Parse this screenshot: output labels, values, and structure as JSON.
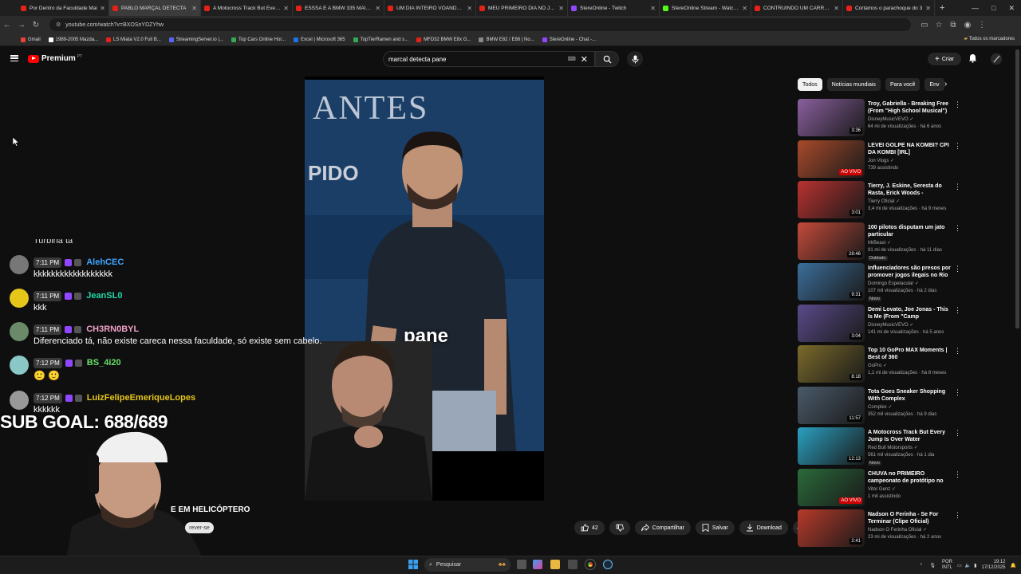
{
  "browser": {
    "tabs": [
      {
        "title": "Por Dentro da Faculdade Mai",
        "color": "#e62117"
      },
      {
        "title": "PABLO MARÇAL DETECTA",
        "color": "#e62117",
        "active": true
      },
      {
        "title": "A Motocross Track But Every J",
        "color": "#e62117"
      },
      {
        "title": "ESSSA É A BMW 335 MAIS LE",
        "color": "#e62117"
      },
      {
        "title": "UM DIA INTEIRO VOANDO PE",
        "color": "#e62117"
      },
      {
        "title": "MEU PRIMEIRO DIA NO JAPÃ",
        "color": "#e62117"
      },
      {
        "title": "StereOnline - Twitch",
        "color": "#9147ff"
      },
      {
        "title": "StereOnline Stream - Watch L",
        "color": "#53fc18"
      },
      {
        "title": "CONTRUINDO UM CARRO EM",
        "color": "#e62117"
      },
      {
        "title": "Cortamos o parachoque do 3",
        "color": "#e62117"
      }
    ],
    "url": "youtube.com/watch?v=BXOSnYDZYhw",
    "bookmarks": [
      {
        "label": "Gmail",
        "color": "#ea4335"
      },
      {
        "label": "1989-2005 Mazda...",
        "color": "#ffffff"
      },
      {
        "label": "LS Miata V2.0 Full B...",
        "color": "#e62117"
      },
      {
        "label": "StreamingServer.io |...",
        "color": "#5865f2"
      },
      {
        "label": "Top Cars Online Hor...",
        "color": "#34a853"
      },
      {
        "label": "Excel | Microsoft 365",
        "color": "#1a73e8"
      },
      {
        "label": "TopTierRamen and s...",
        "color": "#34a853"
      },
      {
        "label": "MFD32 BMW E8x G...",
        "color": "#e62117"
      },
      {
        "label": "BMW E82 / E88 | No...",
        "color": "#888888"
      },
      {
        "label": "StereOnline - Chat -...",
        "color": "#9147ff"
      }
    ],
    "bookmarks_right": "Todos os marcadores"
  },
  "youtube": {
    "logo_text": "Premium",
    "logo_country": "PT",
    "search_value": "marcal detecta pane",
    "create_label": "Criar",
    "caption": "pane",
    "channel_title_fragment": "E EM HELICÓPTERO",
    "subscribe_fragment": "rever-se",
    "likes": "42",
    "share_label": "Compartilhar",
    "save_label": "Salvar",
    "download_label": "Download",
    "chips": [
      "Todos",
      "Notícias mundiais",
      "Para você",
      "Env"
    ],
    "recommendations": [
      {
        "title": "Troy, Gabriella - Breaking Free (From \"High School Musical\")",
        "channel": "DisneyMusicVEVO",
        "meta": "64 mi de visualizações · há 6 anos",
        "duration": "3:36",
        "thumb": "#8a5f9e"
      },
      {
        "title": "LEVEI GOLPE NA KOMBI? CPI DA KOMBI [IRL]",
        "channel": "Jon Vlogs",
        "meta": "739 assistindo",
        "live": "AO VIVO",
        "thumb": "#a84a2a"
      },
      {
        "title": "Tierry, J. Eskine, Seresta do Rasta, Erick Woods - COSTUR...",
        "channel": "Tierry Oficial",
        "meta": "3,4 mi de visualizações · há 9 meses",
        "duration": "3:01",
        "thumb": "#b8322f"
      },
      {
        "title": "100 pilotos disputam um jato particular",
        "channel": "MrBeast",
        "meta": "91 mi de visualizações · há 11 dias",
        "duration": "28:46",
        "thumb": "#c44a3a",
        "note": "Dublado"
      },
      {
        "title": "Influenciadores são presos por promover jogos ilegais no Rio ...",
        "channel": "Domingo Espetacular",
        "meta": "107 mil visualizações · há 2 dias",
        "duration": "9:31",
        "thumb": "#3b6e9a",
        "note": "Novo"
      },
      {
        "title": "Demi Lovato, Joe Jonas - This Is Me (From \"Camp Rock\"/Sin...",
        "channel": "DisneyMusicVEVO",
        "meta": "141 mi de visualizações · há 5 anos",
        "duration": "3:04",
        "thumb": "#5a4a8a"
      },
      {
        "title": "Top 10 GoPro MAX Moments | Best of 360",
        "channel": "GoPro",
        "meta": "1,1 mi de visualizações · há 8 meses",
        "duration": "8:18",
        "thumb": "#7a6a2a"
      },
      {
        "title": "Tota Goes Sneaker Shopping With Complex",
        "channel": "Complex",
        "meta": "352 mil visualizações · há 9 dias",
        "duration": "11:57",
        "thumb": "#4a5a6a"
      },
      {
        "title": "A Motocross Track But Every Jump Is Over Water",
        "channel": "Red Bull Motorsports",
        "meta": "561 mil visualizações · há 1 dia",
        "duration": "12:13",
        "thumb": "#2aa0c0",
        "note": "Novo"
      },
      {
        "title": "CHUVA no PRIMEIRO campeonato de protótipo no L...",
        "channel": "Vitor Genz",
        "meta": "1 mil assistindo",
        "live": "AO VIVO",
        "thumb": "#2a6a3a"
      },
      {
        "title": "Nadson O Ferinha - Se For Terminar (Clipe Oficial)",
        "channel": "Nadson O Ferinha Oficial",
        "meta": "23 mi de visualizações · há 2 anos",
        "duration": "2:41",
        "thumb": "#b83a2a"
      }
    ]
  },
  "chat": {
    "partial_top": "Turbina ta",
    "messages": [
      {
        "time": "7:11 PM",
        "user": "AlehCEC",
        "color": "#3ea6ff",
        "text": "kkkkkkkkkkkkkkkkkk",
        "avatar": "#777777"
      },
      {
        "time": "7:11 PM",
        "user": "JeanSL0",
        "color": "#1fd8a6",
        "text": "kkk",
        "avatar": "#e6c619"
      },
      {
        "time": "7:11 PM",
        "user": "CH3RN0BYL",
        "color": "#f0a0c8",
        "text": "Diferenciado tá, não existe careca nessa faculdade, só existe sem cabelo.",
        "avatar": "#6a8a6a"
      },
      {
        "time": "7:12 PM",
        "user": "BS_4i20",
        "color": "#6ae06a",
        "text": "",
        "avatar": "#8ac8c8"
      },
      {
        "time": "7:12 PM",
        "user": "LuizFelipeEmeriqueLopes",
        "color": "#e6c619",
        "text": "kkkkkk",
        "avatar": "#999999"
      }
    ]
  },
  "overlay": {
    "sub_goal": "SUB GOAL: 688/689"
  },
  "taskbar": {
    "search_placeholder": "Pesquisar",
    "lang": "POR",
    "lang2": "INTL",
    "time": "19:12",
    "date": "17/12/2025"
  }
}
